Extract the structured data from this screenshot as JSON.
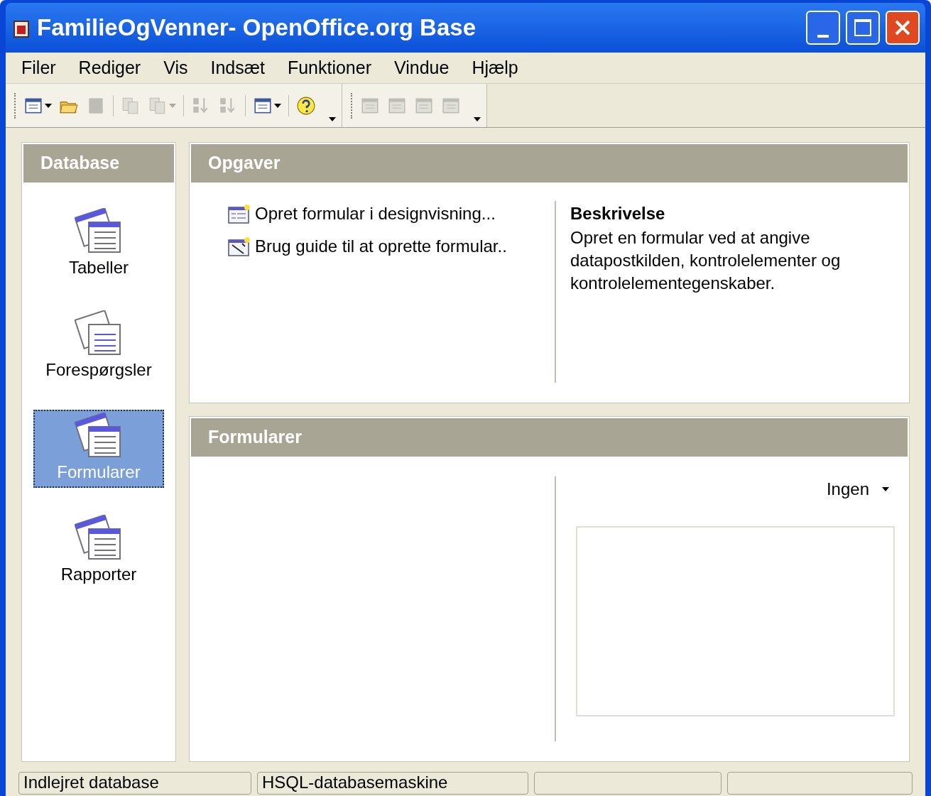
{
  "window": {
    "title": "FamilieOgVenner- OpenOffice.org Base"
  },
  "menu": [
    "Filer",
    "Rediger",
    "Vis",
    "Indsæt",
    "Funktioner",
    "Vindue",
    "Hjælp"
  ],
  "toolbars": [
    [
      {
        "kind": "new",
        "disabled": false,
        "dropdown": true
      },
      {
        "kind": "open",
        "disabled": false,
        "dropdown": false
      },
      {
        "kind": "save",
        "disabled": true,
        "dropdown": false
      },
      {
        "kind": "sep"
      },
      {
        "kind": "copy",
        "disabled": true,
        "dropdown": false
      },
      {
        "kind": "paste",
        "disabled": true,
        "dropdown": true
      },
      {
        "kind": "sep"
      },
      {
        "kind": "sortasc",
        "disabled": true,
        "dropdown": false
      },
      {
        "kind": "sortdesc",
        "disabled": true,
        "dropdown": false
      },
      {
        "kind": "sep"
      },
      {
        "kind": "newform",
        "disabled": false,
        "dropdown": true
      },
      {
        "kind": "sep"
      },
      {
        "kind": "help",
        "disabled": false,
        "dropdown": false
      }
    ],
    [
      {
        "kind": "form",
        "disabled": true,
        "dropdown": false
      },
      {
        "kind": "edit",
        "disabled": true,
        "dropdown": false
      },
      {
        "kind": "image",
        "disabled": true,
        "dropdown": false
      },
      {
        "kind": "list",
        "disabled": true,
        "dropdown": false
      }
    ]
  ],
  "sidebar": {
    "title": "Database",
    "items": [
      {
        "kind": "tables",
        "label": "Tabeller",
        "selected": false
      },
      {
        "kind": "queries",
        "label": "Forespørgsler",
        "selected": false
      },
      {
        "kind": "forms",
        "label": "Formularer",
        "selected": true
      },
      {
        "kind": "reports",
        "label": "Rapporter",
        "selected": false
      }
    ]
  },
  "tasks": {
    "title": "Opgaver",
    "items": [
      {
        "kind": "design",
        "label": "Opret formular i designvisning..."
      },
      {
        "kind": "wizard",
        "label": "Brug guide til at oprette formular.."
      }
    ],
    "description_title": "Beskrivelse",
    "description": "Opret en formular ved at angive datapostkilden, kontrolelementer og kontrolelementegenskaber."
  },
  "forms": {
    "title": "Formularer",
    "preview_option": "Ingen"
  },
  "status_bar": [
    "Indlejret database",
    "HSQL-databasemaskine"
  ]
}
